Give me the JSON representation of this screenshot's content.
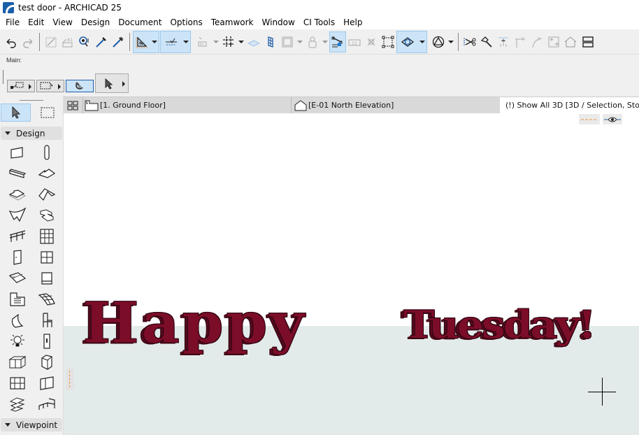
{
  "window": {
    "title": "test door - ARCHICAD 25"
  },
  "menu": [
    "File",
    "Edit",
    "View",
    "Design",
    "Document",
    "Options",
    "Teamwork",
    "Window",
    "CI Tools",
    "Help"
  ],
  "toolbar": {
    "icons": [
      "undo-icon",
      "redo-icon",
      "magic-wand-icon",
      "label-icon",
      "find-select-icon",
      "eyedropper-icon",
      "syringe-icon",
      "guide-lines-icon",
      "snap-guides-icon",
      "relative-construction-icon",
      "grid-snap-icon",
      "layer-plane-icon",
      "3d-window-icon",
      "view-frame-icon",
      "renovation-icon",
      "trace-icon",
      "dimension-icon",
      "fix-icon",
      "group-icon",
      "marquee-3d-icon",
      "sun-icon",
      "split-icon",
      "adjust-icon",
      "elevate-icon",
      "fillet-icon",
      "curve-icon",
      "offset-icon",
      "roof-icon",
      "more-icon"
    ]
  },
  "infobox": {
    "label": "Main:",
    "modes": [
      "polygon-select-mode",
      "marquee-select-mode",
      "magnet-mode"
    ],
    "active_mode": "magnet-mode"
  },
  "toolbox": {
    "sections": [
      {
        "label": "Design",
        "expanded": true
      },
      {
        "label": "Viewpoint",
        "expanded": false
      }
    ],
    "tools": [
      "wall",
      "column",
      "beam",
      "slab",
      "roof-slab",
      "shell",
      "mesh-roof",
      "stair",
      "railing",
      "curtain-wall",
      "door",
      "window",
      "skylight",
      "corner-window",
      "zone",
      "mesh",
      "morph",
      "object",
      "lamp",
      "switch",
      "cabinet",
      "appliance",
      "wall-end",
      "panel",
      "stair-tool",
      "railing-tool"
    ]
  },
  "tabs": [
    {
      "label": "[1. Ground Floor]",
      "icon": "floor-plan-icon",
      "active": false
    },
    {
      "label": "[E-01 North Elevation]",
      "icon": "elevation-icon",
      "active": false
    },
    {
      "label": "(!) Show All 3D [3D / Selection, Sto",
      "icon": "3d-view-icon",
      "active": true
    }
  ],
  "viewport": {
    "text_objects": [
      {
        "text": "Happy"
      },
      {
        "text": "Tuesday!"
      }
    ],
    "colors": {
      "text": "#7b0d28",
      "ground": "#e3ebea",
      "sky": "#ffffff"
    }
  }
}
